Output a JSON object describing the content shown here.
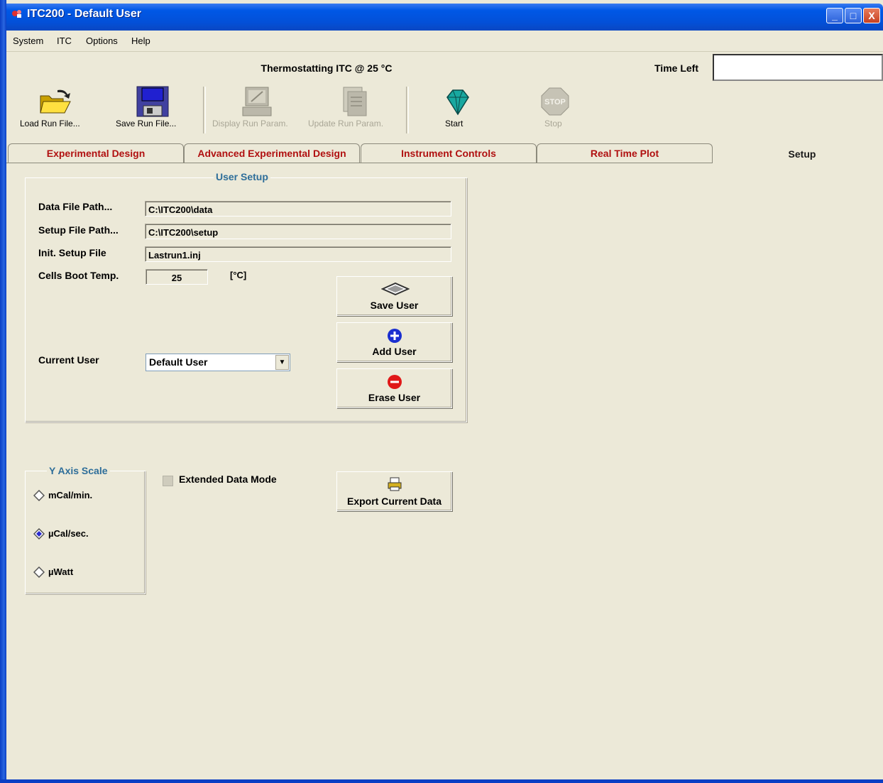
{
  "window": {
    "title": "ITC200 - Default User",
    "controls": {
      "minimize": "_",
      "maximize": "□",
      "close": "X"
    }
  },
  "menu": [
    {
      "label": "System"
    },
    {
      "label": "ITC"
    },
    {
      "label": "Options"
    },
    {
      "label": "Help"
    }
  ],
  "status": {
    "title": "Thermostatting ITC @ 25 °C",
    "time_left_label": "Time Left",
    "time_left_value": ""
  },
  "toolbar": [
    {
      "label": "Load Run File...",
      "icon": "open-folder-icon",
      "enabled": true
    },
    {
      "label": "Save Run File...",
      "icon": "floppy-disk-icon",
      "enabled": true
    },
    {
      "label": "Display Run Param.",
      "icon": "monitor-icon",
      "enabled": false
    },
    {
      "label": "Update Run Param.",
      "icon": "update-document-icon",
      "enabled": false
    },
    {
      "label": "Start",
      "icon": "start-gem-icon",
      "enabled": true
    },
    {
      "label": "Stop",
      "icon": "stop-sign-icon",
      "enabled": false
    }
  ],
  "tabs": [
    {
      "label": "Experimental Design"
    },
    {
      "label": "Advanced Experimental Design"
    },
    {
      "label": "Instrument Controls"
    },
    {
      "label": "Real Time Plot"
    },
    {
      "label": "Setup",
      "active": true
    }
  ],
  "user_setup": {
    "legend": "User Setup",
    "data_file_path_label": "Data File Path...",
    "data_file_path_value": "C:\\ITC200\\data",
    "setup_file_path_label": "Setup File Path...",
    "setup_file_path_value": "C:\\ITC200\\setup",
    "init_setup_file_label": "Init. Setup File",
    "init_setup_file_value": "Lastrun1.inj",
    "cells_boot_temp_label": "Cells Boot Temp.",
    "cells_boot_temp_value": "25",
    "cells_boot_temp_unit": "[°C]",
    "current_user_label": "Current User",
    "current_user_value": "Default User",
    "save_user": "Save User",
    "add_user": "Add User",
    "erase_user": "Erase User"
  },
  "y_axis_scale": {
    "legend": "Y Axis Scale",
    "options": [
      {
        "label": "mCal/min.",
        "selected": false
      },
      {
        "label": "µCal/sec.",
        "selected": true
      },
      {
        "label": "µWatt",
        "selected": false
      }
    ]
  },
  "extended_data_mode_label": "Extended Data Mode",
  "extended_data_mode_checked": false,
  "export_current_data": "Export Current Data",
  "colors": {
    "titlebar": "#0058e6",
    "tab_text": "#b01010",
    "group_legend": "#2e6e9a",
    "add_icon": "#1a2fd0",
    "erase_icon": "#e01818"
  }
}
